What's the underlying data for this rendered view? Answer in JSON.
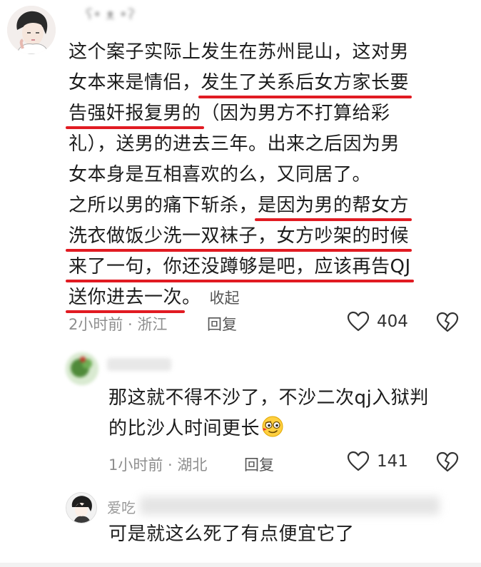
{
  "comments": [
    {
      "username": "ʕ• ᴥ •ʔ",
      "lines": [
        [
          "这个案子实际上发生在苏州昆山，这对男"
        ],
        [
          "女本来是情侣，",
          {
            "hl": "发生了关系后女方家长要"
          }
        ],
        [
          {
            "hl": "告强奸报复男的"
          },
          "（因为男方不打算给彩"
        ],
        [
          "礼），送男的进去三年。出来之后因为男"
        ],
        [
          "女本身是互相喜欢的么，又同居了。"
        ],
        [
          "之所以男的痛下斩杀，",
          {
            "hl": "是因为男的帮女方"
          }
        ],
        [
          {
            "hl": "洗衣做饭少洗一双袜子，女方吵架的时候"
          }
        ],
        [
          {
            "hl": "来了一句，你还没蹲够是吧，应该再告QJ"
          }
        ],
        [
          {
            "hl": "送你进去一次"
          },
          "。"
        ]
      ],
      "collapse_label": "收起",
      "time": "2小时前",
      "location": "浙江",
      "reply_label": "回复",
      "likes": "404"
    },
    {
      "username": "",
      "lines": [
        [
          "那这就不得不沙了，不沙二次qj入狱判"
        ],
        [
          "的比沙人时间更长"
        ]
      ],
      "time": "1小时前",
      "location": "湖北",
      "reply_label": "回复",
      "likes": "141"
    },
    {
      "username": "爱吃",
      "lines": [
        [
          "可是就这么死了有点便宜它了"
        ]
      ]
    }
  ],
  "meta_separator": " · ",
  "colors": {
    "highlight_underline": "#e11b22",
    "meta_text": "#8e8e8e",
    "body_text": "#1c1c1c"
  },
  "icons": [
    "avatar-boy-illustration",
    "avatar-green-blurred",
    "avatar-anime-character",
    "heart-icon",
    "broken-heart-icon",
    "smirk-emoji"
  ]
}
